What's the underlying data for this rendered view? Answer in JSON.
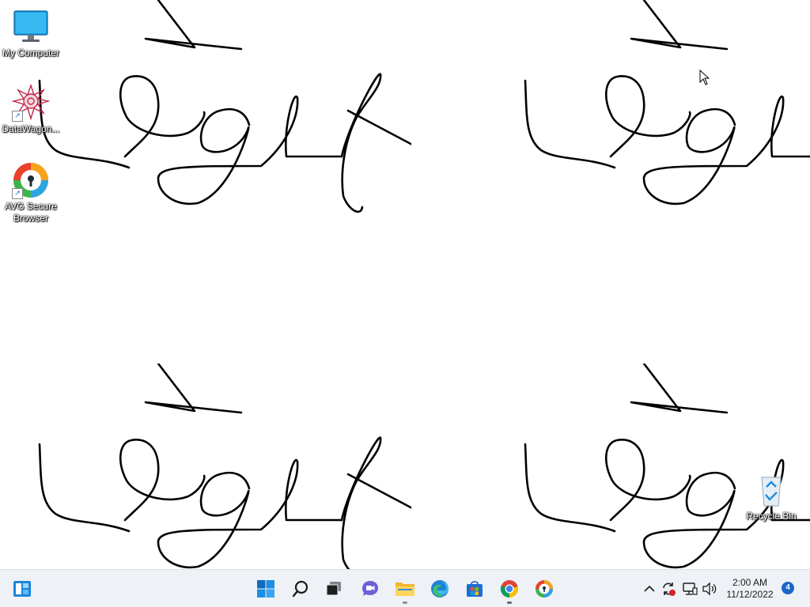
{
  "desktop": {
    "icons": [
      {
        "label": "My Computer",
        "icon": "monitor-icon"
      },
      {
        "label": "DataWagon...",
        "icon": "datawagon-icon"
      },
      {
        "label": "AVG Secure Browser",
        "icon": "avg-browser-icon"
      },
      {
        "label": "Recycle Bin",
        "icon": "recycle-bin-icon"
      }
    ],
    "wallpaper": "repeating handwritten signature scribble",
    "background_color": "#ffffff"
  },
  "taskbar": {
    "left": {
      "widgets_icon": "widgets-icon"
    },
    "pinned": [
      {
        "name": "Start",
        "icon": "windows-start-icon"
      },
      {
        "name": "Search",
        "icon": "search-icon"
      },
      {
        "name": "Task View",
        "icon": "task-view-icon"
      },
      {
        "name": "Chat",
        "icon": "chat-icon"
      },
      {
        "name": "File Explorer",
        "icon": "folder-icon"
      },
      {
        "name": "Microsoft Edge",
        "icon": "edge-icon"
      },
      {
        "name": "Microsoft Store",
        "icon": "store-icon"
      },
      {
        "name": "Google Chrome",
        "icon": "chrome-icon"
      },
      {
        "name": "AVG Secure Browser",
        "icon": "avg-browser-icon"
      }
    ],
    "tray": {
      "icons": [
        "chevron-up-icon",
        "sync-alert-icon",
        "network-icon",
        "volume-icon"
      ],
      "time": "2:00 AM",
      "date": "11/12/2022",
      "notification_count": "4"
    },
    "accent_color": "#0078d4"
  }
}
